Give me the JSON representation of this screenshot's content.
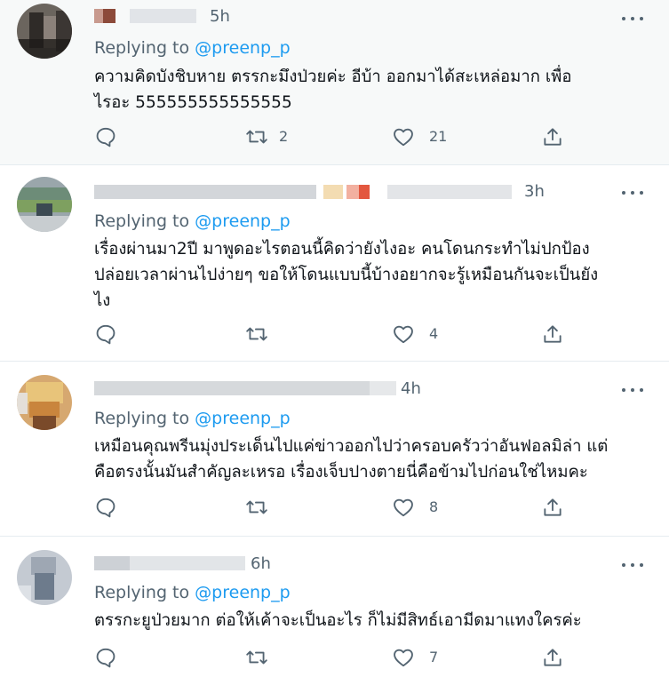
{
  "replies": [
    {
      "time": "5h",
      "replying_label": "Replying to",
      "handle": "@preenp_p",
      "lines": [
        "ความคิดบังชิบหาย ตรรกะมึงป่วยค่ะ อีบ้า ออกมาได้สะเหล่อมาก เพื่อ",
        "ไรอะ 555555555555555"
      ],
      "retweets": "2",
      "likes": "21"
    },
    {
      "time": "3h",
      "replying_label": "Replying to",
      "handle": "@preenp_p",
      "lines": [
        "เรื่องผ่านมา2ปี มาพูดอะไรตอนนี้คิดว่ายังไงอะ คนโดนกระทำไม่ปกป้อง",
        "ปล่อยเวลาผ่านไปง่ายๆ ขอให้โดนแบบนี้บ้างอยากจะรู้เหมือนกันจะเป็นยัง",
        "ไง"
      ],
      "retweets": "",
      "likes": "4"
    },
    {
      "time": "4h",
      "replying_label": "Replying to",
      "handle": "@preenp_p",
      "lines": [
        "เหมือนคุณพรีนมุ่งประเด็นไปแค่ข่าวออกไปว่าครอบครัวว่าอันฟอลมิล่า แต่",
        "คือตรงนั้นมันสำคัญละเหรอ เรื่องเจ็บปางตายนี่คือข้ามไปก่อนใช่ไหมคะ"
      ],
      "retweets": "",
      "likes": "8"
    },
    {
      "time": "6h",
      "replying_label": "Replying to",
      "handle": "@preenp_p",
      "lines": [
        "ตรรกะยูป่วยมาก ต่อให้เค้าจะเป็นอะไร ก็ไม่มีสิทธ์เอามีดมาแทงใครค่ะ"
      ],
      "retweets": "",
      "likes": "7"
    }
  ],
  "colors": {
    "link": "#1d9bf0",
    "muted": "#536471",
    "text": "#0f1419",
    "highlight_bg": "#f7f9f9",
    "divider": "#e6ecf0"
  },
  "icons": {
    "reply": "reply-icon",
    "retweet": "retweet-icon",
    "like": "heart-icon",
    "share": "share-icon",
    "more": "more-icon"
  }
}
